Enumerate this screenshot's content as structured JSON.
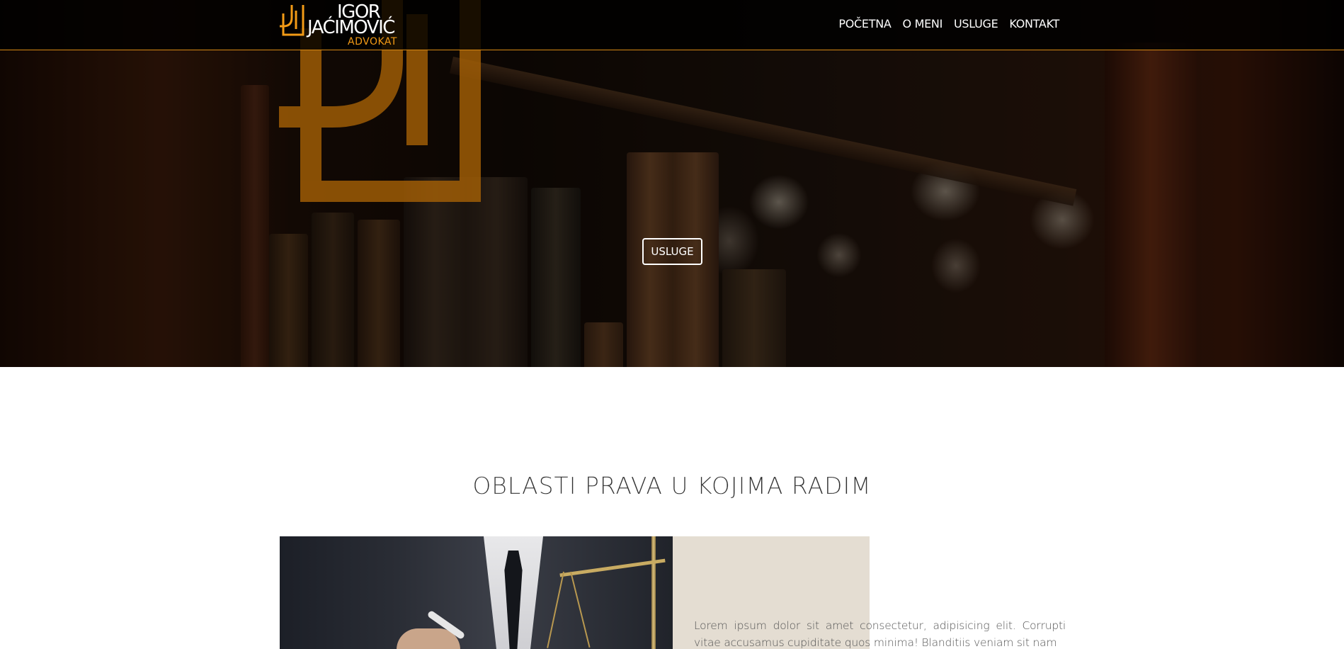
{
  "navbar": {
    "logo": {
      "name_line1": "IGOR",
      "name_line2": "JAĆIMOVIĆ",
      "subtitle": "ADVOKAT",
      "mark_icon": "ij-monogram-icon"
    },
    "links": [
      {
        "label": "POČETNA"
      },
      {
        "label": "O MENI"
      },
      {
        "label": "USLUGE"
      },
      {
        "label": "KONTAKT"
      }
    ],
    "accent_color": "#d88914"
  },
  "hero": {
    "button_label": "USLUGE",
    "background": "law-books-photo",
    "monogram_color": "#a35f06"
  },
  "section": {
    "title": "OBLASTI PRAVA U KOJIMA RADIM",
    "image": "lawyer-with-scales-photo",
    "text": "Lorem ipsum dolor sit amet consectetur, adipisicing elit. Corrupti vitae accusamus cupiditate quos minima! Blanditiis veniam sit nam",
    "block_color": "#e4ddd2"
  }
}
